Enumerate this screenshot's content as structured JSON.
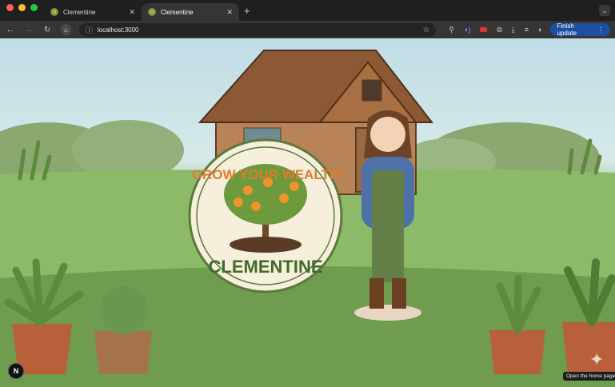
{
  "browser": {
    "tabs": [
      {
        "label": "Clementine",
        "active": false
      },
      {
        "label": "Clementine",
        "active": true
      }
    ],
    "url": "localhost:3000",
    "finish_update_label": "Finish update",
    "accent_color": "#1c4fa0"
  },
  "page": {
    "logo_top_text": "GROW YOUR WEALTH",
    "logo_bottom_text": "CLEMENTINE"
  },
  "overlay": {
    "dev_badge": "N",
    "tooltip": "Open the home page"
  },
  "icons": {
    "back": "back-arrow-icon",
    "forward": "forward-arrow-icon",
    "reload": "reload-icon",
    "home": "home-icon",
    "site_info": "site-info-icon",
    "bookmark": "star-icon",
    "extensions": "puzzle-icon",
    "download": "download-icon",
    "tab_search": "tab-search-icon",
    "profile": "profile-icon",
    "menu": "kebab-menu-icon"
  }
}
